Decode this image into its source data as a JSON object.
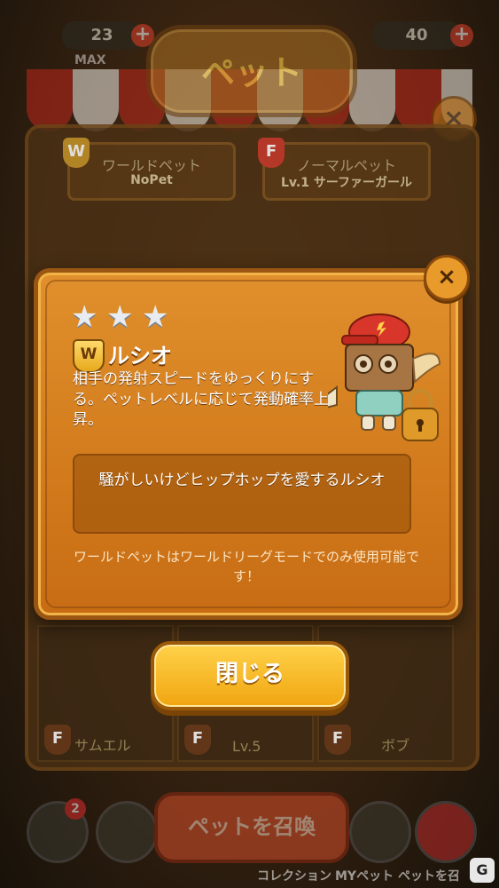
{
  "header": {
    "title": "ペット",
    "left_count": "23",
    "left_badge": "MAX",
    "right_count": "40"
  },
  "slots": {
    "world": {
      "icon": "W",
      "label": "ワールドペット",
      "value": "NoPet"
    },
    "normal": {
      "icon": "F",
      "label": "ノーマルペット",
      "value": "Lv.1 サーファーガール"
    }
  },
  "grid": {
    "items": [
      {
        "icon": "F",
        "label": "サムエル"
      },
      {
        "icon": "F",
        "label": "Lv.5"
      },
      {
        "icon": "F",
        "label": "ボブ"
      }
    ]
  },
  "bottom": {
    "summon_label": "ペットを召喚",
    "gift_badge": "2",
    "label_left": "コレクション",
    "label_right": "MYペット ペットを召"
  },
  "dialog": {
    "star_rating": 3,
    "stars": [
      "★",
      "★",
      "★"
    ],
    "badge": "W",
    "pet_name": "ルシオ",
    "description": "相手の発射スピードをゆっくりにする。ペットレベルに応じて発動確率上昇。",
    "quote": "騒がしいけどヒップホップを愛するルシオ",
    "note": "ワールドペットはワールドリーグモードでのみ使用可能です！",
    "close_label": "閉じる",
    "close_icon": "×"
  },
  "watermark": "G",
  "colors": {
    "accent": "#f0a510",
    "dialog": "#d27a1c",
    "badge_red": "#e02c2c"
  }
}
